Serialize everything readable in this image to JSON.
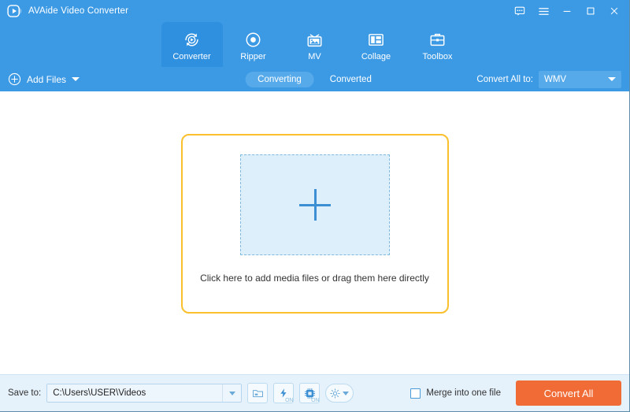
{
  "window": {
    "app_title": "AVAide Video Converter",
    "logo_icon": "play-logo-icon",
    "controls": [
      {
        "name": "feedback-icon",
        "label": "Feedback"
      },
      {
        "name": "menu-icon",
        "label": "Menu"
      },
      {
        "name": "minimize-icon",
        "label": "Minimize"
      },
      {
        "name": "maximize-icon",
        "label": "Maximize"
      },
      {
        "name": "close-icon",
        "label": "Close"
      }
    ]
  },
  "nav": {
    "tabs": [
      {
        "label": "Converter",
        "icon": "converter-icon",
        "active": true
      },
      {
        "label": "Ripper",
        "icon": "ripper-disc-icon",
        "active": false
      },
      {
        "label": "MV",
        "icon": "mv-tv-icon",
        "active": false
      },
      {
        "label": "Collage",
        "icon": "collage-grid-icon",
        "active": false
      },
      {
        "label": "Toolbox",
        "icon": "toolbox-briefcase-icon",
        "active": false
      }
    ]
  },
  "toolbar": {
    "add_files_label": "Add Files",
    "add_files_icon": "plus-circle-icon",
    "add_files_caret_icon": "chevron-down-icon",
    "segments": [
      {
        "label": "Converting",
        "active": true
      },
      {
        "label": "Converted",
        "active": false
      }
    ],
    "convert_all_to_label": "Convert All to:",
    "convert_all_to_value": "WMV",
    "convert_all_to_caret_icon": "chevron-down-icon"
  },
  "dropzone": {
    "plus_icon": "plus-icon",
    "hint": "Click here to add media files or drag them here directly"
  },
  "bottom": {
    "save_to_label": "Save to:",
    "save_to_path": "C:\\Users\\USER\\Videos",
    "path_caret_icon": "chevron-down-icon",
    "open_folder_icon": "folder-icon",
    "hardware_accel_icon": "lightning-bolt-icon",
    "hardware_accel_state": "ON",
    "gpu_accel_icon": "gpu-chip-icon",
    "gpu_accel_state": "ON",
    "settings_icon": "gear-icon",
    "settings_caret_icon": "chevron-down-icon",
    "merge_label": "Merge into one file",
    "merge_checked": false,
    "convert_all_label": "Convert All"
  },
  "colors": {
    "header_blue": "#3c9ae5",
    "active_tab_blue": "#2f90e0",
    "segment_blue": "#57aaea",
    "dropzone_border_yellow": "#fbc02d",
    "dropzone_fill_blue": "#dceffb",
    "plus_blue": "#3d8fd4",
    "bottom_bar_blue": "#e5f1fb",
    "convert_orange": "#f06b35"
  }
}
